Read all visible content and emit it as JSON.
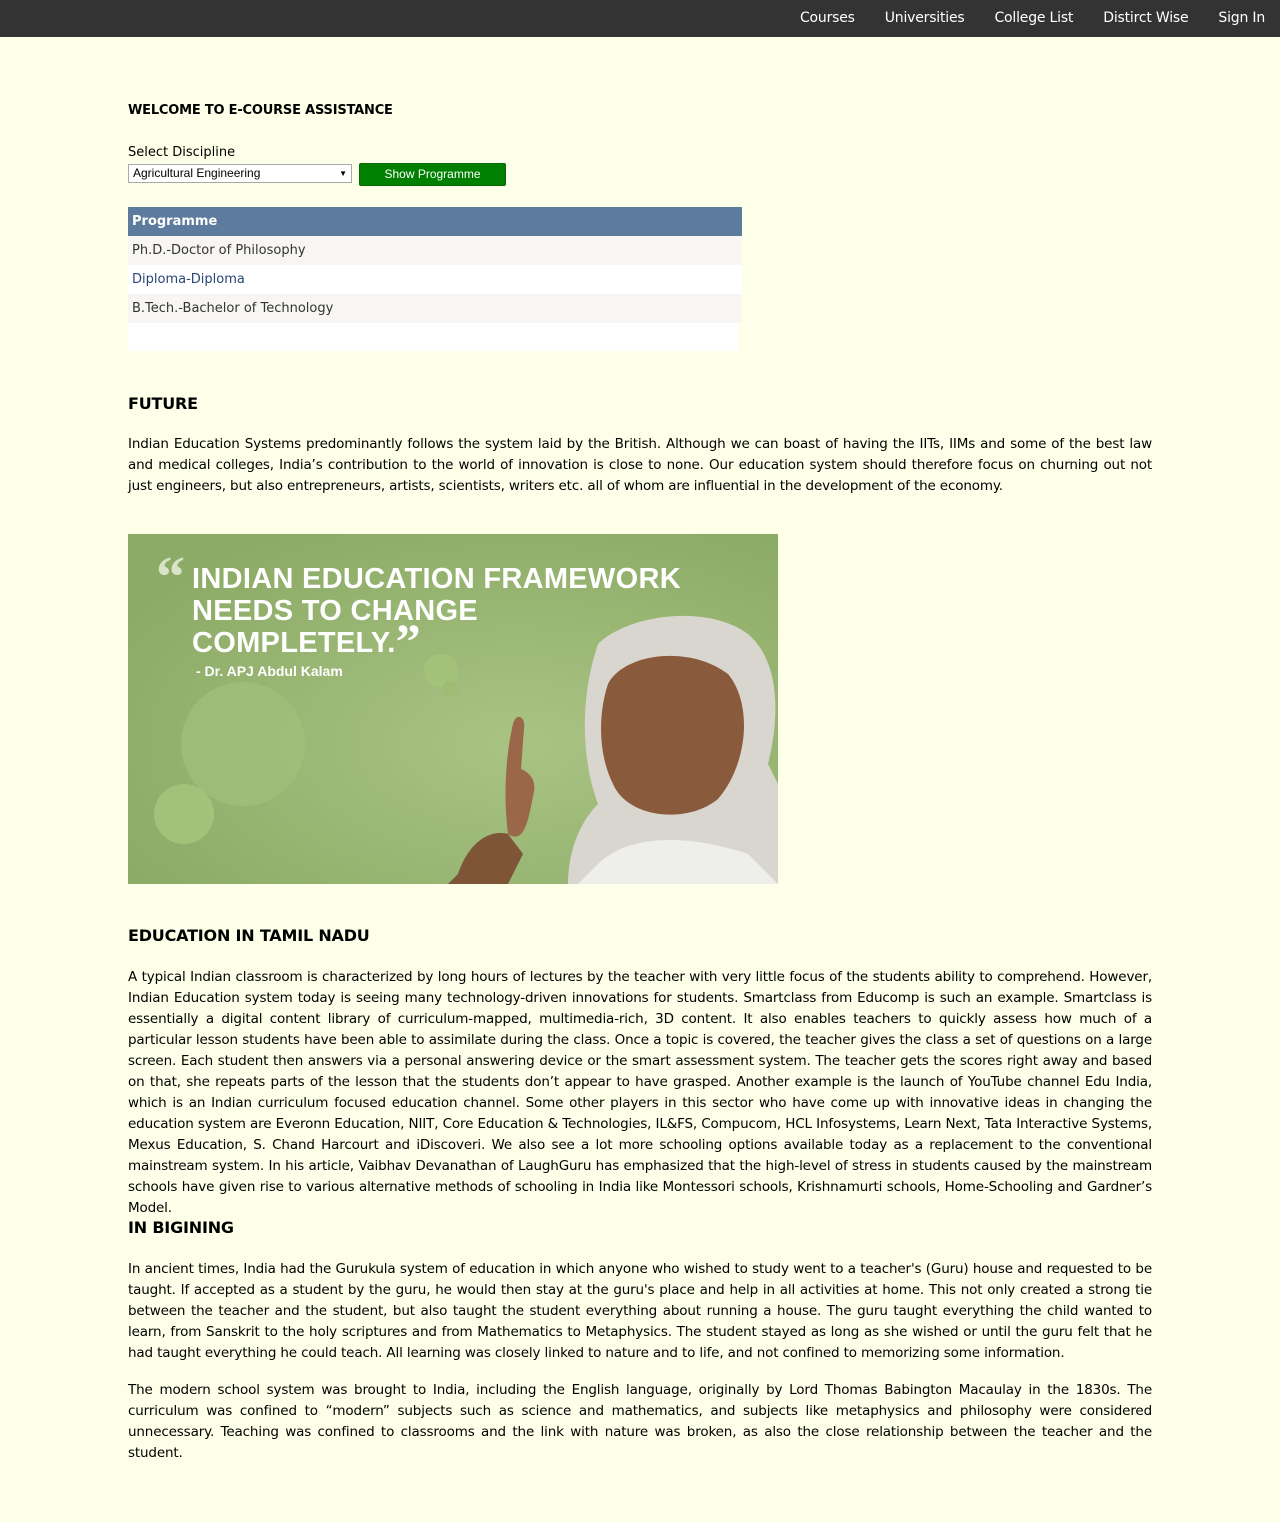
{
  "nav": {
    "items": [
      "Courses",
      "Universities",
      "College List",
      "Distirct Wise",
      "Sign In"
    ]
  },
  "welcome_title": "WELCOME TO E-COURSE ASSISTANCE",
  "discipline": {
    "label": "Select Discipline",
    "selected": "Agricultural Engineering",
    "button_label": "Show Programme"
  },
  "programme_table": {
    "header": "Programme",
    "rows": [
      "Ph.D.-Doctor of Philosophy",
      "Diploma-Diploma",
      "B.Tech.-Bachelor of Technology"
    ]
  },
  "future": {
    "heading": "FUTURE",
    "text": "Indian Education Systems predominantly follows the system laid by the British. Although we can boast of having the IITs, IIMs and some of the best law and medical colleges, India’s contribution to the world of innovation is close to none. Our education system should therefore focus on churning out not just engineers, but also entrepreneurs, artists, scientists, writers etc. all of whom are influential in the development of the economy."
  },
  "banner": {
    "quote_line1": "INDIAN EDUCATION FRAMEWORK",
    "quote_line2": "NEEDS TO CHANGE",
    "quote_line3": "COMPLETELY.",
    "attribution": "- Dr. APJ Abdul Kalam",
    "bg_color": "#97b471"
  },
  "tamil_nadu": {
    "heading": "EDUCATION IN TAMIL NADU",
    "text": "A typical Indian classroom is characterized by long hours of lectures by the teacher with very little focus of the students ability to comprehend. However, Indian Education system today is seeing many technology-driven innovations for students. Smartclass from Educomp is such an example. Smartclass is essentially a digital content library of curriculum-mapped, multimedia-rich, 3D content. It also enables teachers to quickly assess how much of a particular lesson students have been able to assimilate during the class. Once a topic is covered, the teacher gives the class a set of questions on a large screen. Each student then answers via a personal answering device or the smart assessment system. The teacher gets the scores right away and based on that, she repeats parts of the lesson that the students don’t appear to have grasped. Another example is the launch of YouTube channel Edu India, which is an Indian curriculum focused education channel. Some other players in this sector who have come up with innovative ideas in changing the education system are Everonn Education, NIIT, Core Education & Technologies, IL&FS, Compucom, HCL Infosystems, Learn Next, Tata Interactive Systems, Mexus Education, S. Chand Harcourt and iDiscoveri. We also see a lot more schooling options available today as a replacement to the conventional mainstream system. In his article, Vaibhav Devanathan of LaughGuru has emphasized that the high-level of stress in students caused by the mainstream schools have given rise to various alternative methods of schooling in India like Montessori schools, Krishnamurti schools, Home-Schooling and Gardner’s Model."
  },
  "beginning": {
    "heading": "IN BIGINING",
    "text1": "In ancient times, India had the Gurukula system of education in which anyone who wished to study went to a teacher's (Guru) house and requested to be taught. If accepted as a student by the guru, he would then stay at the guru's place and help in all activities at home. This not only created a strong tie between the teacher and the student, but also taught the student everything about running a house. The guru taught everything the child wanted to learn, from Sanskrit to the holy scriptures and from Mathematics to Metaphysics. The student stayed as long as she wished or until the guru felt that he had taught everything he could teach. All learning was closely linked to nature and to life, and not confined to memorizing some information.",
    "text2": "The modern school system was brought to India, including the English language, originally by Lord Thomas Babington Macaulay in the 1830s. The curriculum was confined to “modern” subjects such as science and mathematics, and subjects like metaphysics and philosophy were considered unnecessary. Teaching was confined to classrooms and the link with nature was broken, as also the close relationship between the teacher and the student."
  }
}
